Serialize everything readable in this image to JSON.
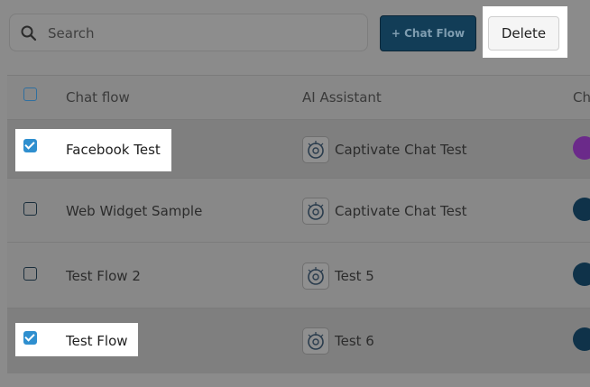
{
  "search": {
    "placeholder": "Search"
  },
  "toolbar": {
    "chat_flow_label": "+ Chat Flow",
    "delete_label": "Delete"
  },
  "table": {
    "headers": {
      "chat_flow": "Chat flow",
      "ai_assistant": "AI Assistant",
      "channel": "Ch"
    },
    "rows": [
      {
        "name": "Facebook Test",
        "assistant": "Captivate Chat Test",
        "checked": true,
        "channel_icon": "messenger-icon"
      },
      {
        "name": "Web Widget Sample",
        "assistant": "Captivate Chat Test",
        "checked": false,
        "channel_icon": "web-widget-icon"
      },
      {
        "name": "Test Flow 2",
        "assistant": "Test 5",
        "checked": false,
        "channel_icon": "web-widget-icon"
      },
      {
        "name": "Test Flow",
        "assistant": "Test 6",
        "checked": true,
        "channel_icon": "web-widget-icon"
      }
    ]
  },
  "colors": {
    "primary": "#123d57",
    "checkbox": "#2f8fcf",
    "overlay_dim": "#8b8b8b"
  }
}
